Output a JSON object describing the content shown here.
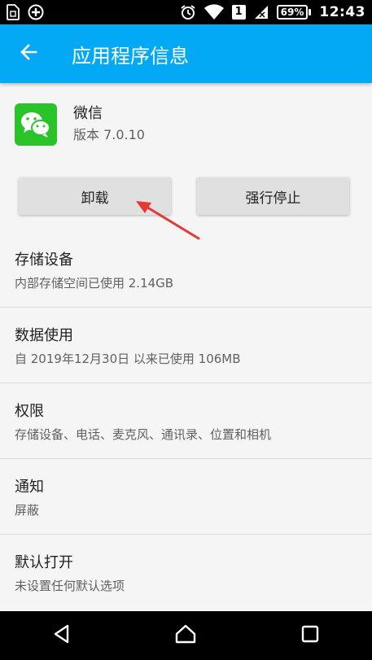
{
  "statusbar": {
    "left_icons": [
      "sim-card-icon",
      "add-circle-icon"
    ],
    "sim_number": "1",
    "battery": "69%",
    "time": "12:43"
  },
  "appbar": {
    "title": "应用程序信息",
    "color": "#03a9f4"
  },
  "app": {
    "name": "微信",
    "version": "版本 7.0.10",
    "icon": "wechat-icon",
    "icon_color": "#2ac32a"
  },
  "buttons": {
    "uninstall": "卸载",
    "force_stop": "强行停止"
  },
  "annotation": {
    "arrow_color": "#e53935"
  },
  "settings": [
    {
      "title": "存储设备",
      "subtitle": "内部存储空间已使用 2.14GB"
    },
    {
      "title": "数据使用",
      "subtitle": "自 2019年12月30日 以来已使用 106MB"
    },
    {
      "title": "权限",
      "subtitle": "存储设备、电话、麦克风、通讯录、位置和相机"
    },
    {
      "title": "通知",
      "subtitle": "屏蔽"
    },
    {
      "title": "默认打开",
      "subtitle": "未设置任何默认选项"
    }
  ],
  "navbar": [
    "back-icon",
    "home-icon",
    "recents-icon"
  ]
}
